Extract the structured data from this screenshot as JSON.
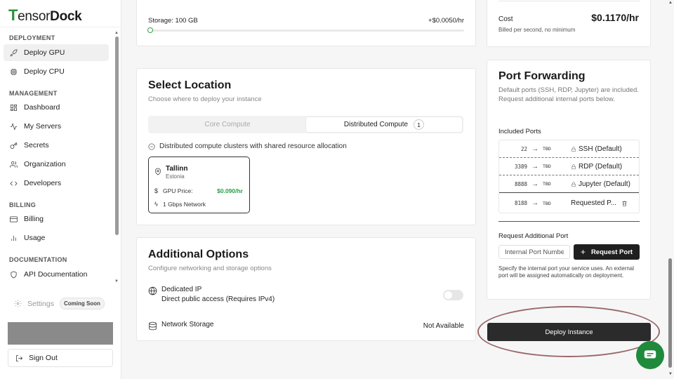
{
  "brand": {
    "first_letter": "T",
    "rest": "ensor",
    "bold": "Dock"
  },
  "sidebar": {
    "sections": [
      {
        "title": "DEPLOYMENT"
      },
      {
        "title": "MANAGEMENT"
      },
      {
        "title": "BILLING"
      },
      {
        "title": "DOCUMENTATION"
      }
    ],
    "items": [
      {
        "label": "Deploy GPU",
        "icon": "rocket-icon"
      },
      {
        "label": "Deploy CPU",
        "icon": "cpu-icon"
      },
      {
        "label": "Dashboard",
        "icon": "dashboard-icon"
      },
      {
        "label": "My Servers",
        "icon": "activity-icon"
      },
      {
        "label": "Secrets",
        "icon": "key-icon"
      },
      {
        "label": "Organization",
        "icon": "users-icon"
      },
      {
        "label": "Developers",
        "icon": "code-icon"
      },
      {
        "label": "Billing",
        "icon": "credit-card-icon"
      },
      {
        "label": "Usage",
        "icon": "bar-chart-icon"
      },
      {
        "label": "API Documentation",
        "icon": "shield-icon"
      }
    ],
    "settings_label": "Settings",
    "coming_soon": "Coming Soon",
    "sign_out": "Sign Out"
  },
  "storage": {
    "label": "Storage: 100 GB",
    "price": "+$0.0050/hr",
    "slider_value": 0
  },
  "location": {
    "title": "Select Location",
    "subtitle": "Choose where to deploy your instance",
    "tab_core": "Core Compute",
    "tab_distributed": "Distributed Compute",
    "tab_distributed_count": "1",
    "info": "Distributed compute clusters with shared resource allocation",
    "card": {
      "city": "Tallinn",
      "country": "Estonia",
      "gpu_price_label": "GPU Price:",
      "gpu_price": "$0.090/hr",
      "network": "1 Gbps Network"
    }
  },
  "options": {
    "title": "Additional Options",
    "subtitle": "Configure networking and storage options",
    "dedicated_ip_title": "Dedicated IP",
    "dedicated_ip_desc": "Direct public access (Requires IPv4)",
    "network_storage": "Network Storage",
    "network_storage_status": "Not Available"
  },
  "cost": {
    "label": "Cost",
    "value": "$0.1170/hr",
    "note": "Billed per second, no minimum"
  },
  "port_forwarding": {
    "title": "Port Forwarding",
    "description": "Default ports (SSH, RDP, Jupyter) are included. Request additional internal ports below.",
    "included_label": "Included Ports",
    "ports": [
      {
        "internal": "22",
        "external": "TBD",
        "name": "SSH (Default)"
      },
      {
        "internal": "3389",
        "external": "TBD",
        "name": "RDP (Default)"
      },
      {
        "internal": "8888",
        "external": "TBD",
        "name": "Jupyter (Default)"
      },
      {
        "internal": "8188",
        "external": "TBD",
        "name": "Requested P..."
      }
    ],
    "request_label": "Request Additional Port",
    "input_placeholder": "Internal Port Number",
    "request_button": "Request Port",
    "note": "Specify the internal port your service uses. An external port will be assigned automatically on deployment."
  },
  "deploy_button": "Deploy Instance",
  "colors": {
    "accent_green": "#23a046",
    "brand_green": "#2f8f3e",
    "dark_button": "#1f1f1f"
  }
}
